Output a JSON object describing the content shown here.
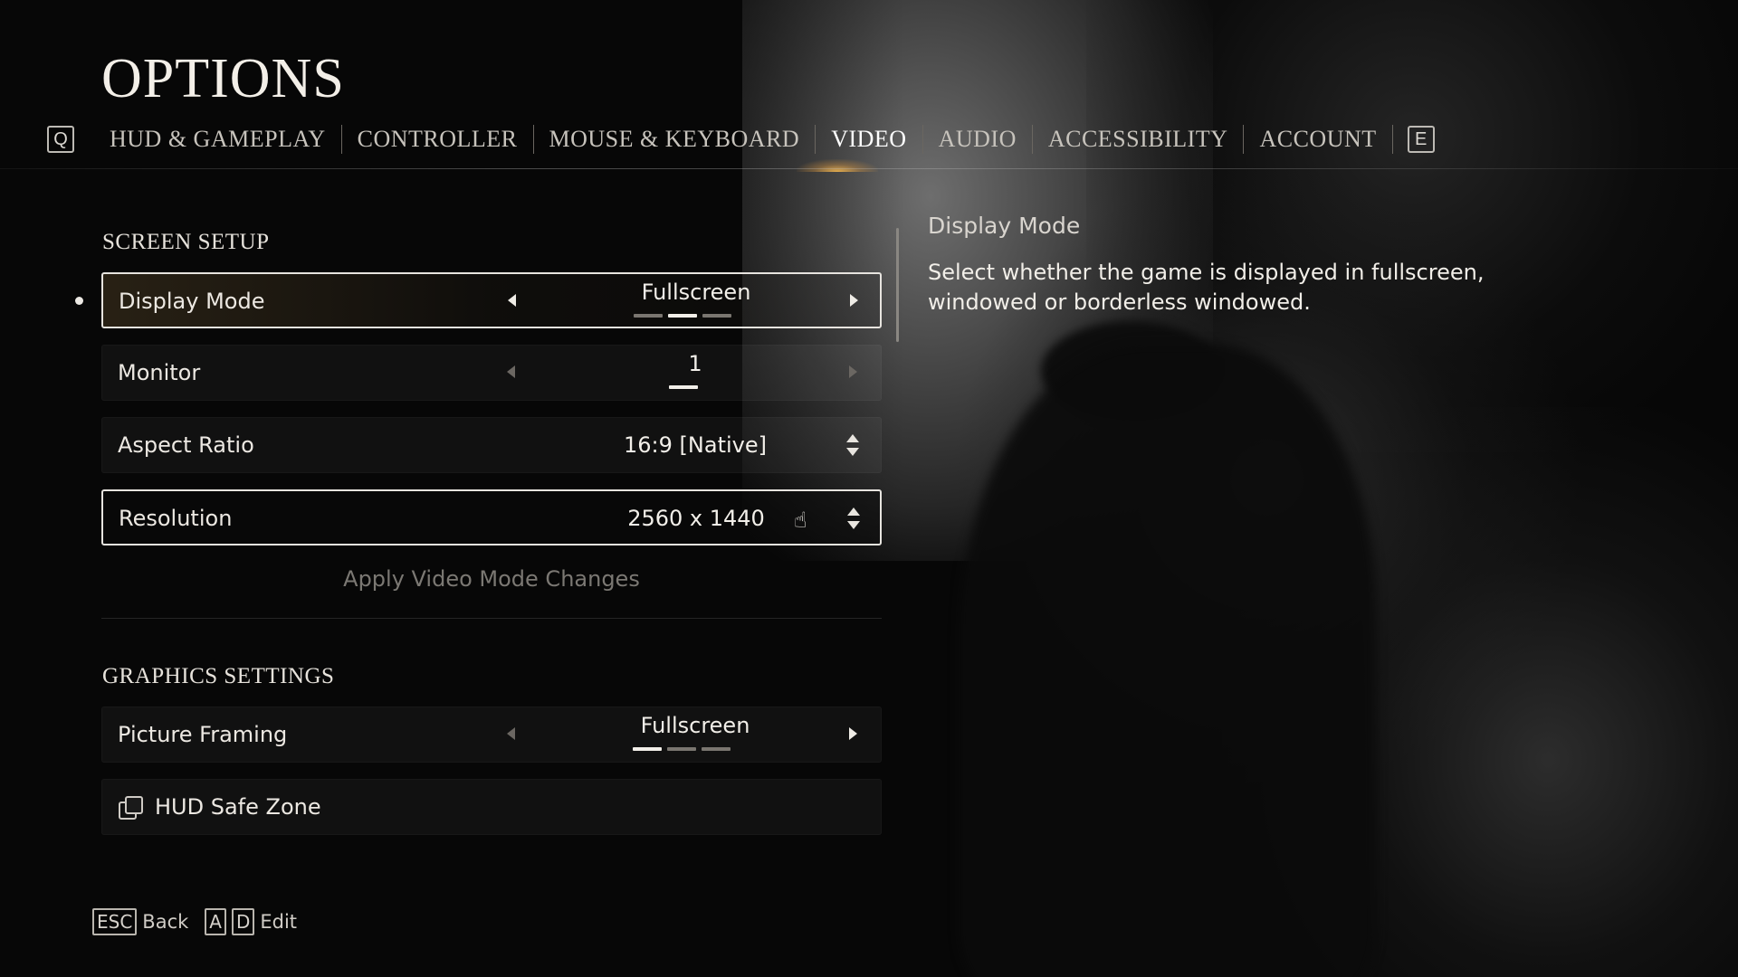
{
  "title": "OPTIONS",
  "tabs": {
    "prev_key": "Q",
    "next_key": "E",
    "items": [
      {
        "label": "HUD & GAMEPLAY",
        "active": false
      },
      {
        "label": "CONTROLLER",
        "active": false
      },
      {
        "label": "MOUSE & KEYBOARD",
        "active": false
      },
      {
        "label": "VIDEO",
        "active": true
      },
      {
        "label": "AUDIO",
        "active": false
      },
      {
        "label": "ACCESSIBILITY",
        "active": false
      },
      {
        "label": "ACCOUNT",
        "active": false
      }
    ]
  },
  "screen_setup": {
    "heading": "SCREEN SETUP",
    "display_mode": {
      "label": "Display Mode",
      "value": "Fullscreen",
      "option_index": 2,
      "option_count": 3
    },
    "monitor": {
      "label": "Monitor",
      "value": "1",
      "option_index": 1,
      "option_count": 1
    },
    "aspect_ratio": {
      "label": "Aspect Ratio",
      "value": "16:9 [Native]"
    },
    "resolution": {
      "label": "Resolution",
      "value": "2560 x 1440"
    },
    "apply_label": "Apply Video Mode Changes"
  },
  "graphics_settings": {
    "heading": "GRAPHICS SETTINGS",
    "picture_framing": {
      "label": "Picture Framing",
      "value": "Fullscreen",
      "option_index": 1,
      "option_count": 3
    },
    "hud_safe_zone": {
      "label": "HUD Safe Zone"
    }
  },
  "description": {
    "title": "Display Mode",
    "text": "Select whether the game is displayed in fullscreen, windowed or borderless windowed."
  },
  "footer": {
    "back_key": "ESC",
    "back_label": "Back",
    "edit_key_left": "A",
    "edit_key_right": "D",
    "edit_label": "Edit"
  },
  "colors": {
    "accent_glow": "#ffbe50",
    "text": "#e9e6e1",
    "selected_border": "#e7e4df"
  }
}
